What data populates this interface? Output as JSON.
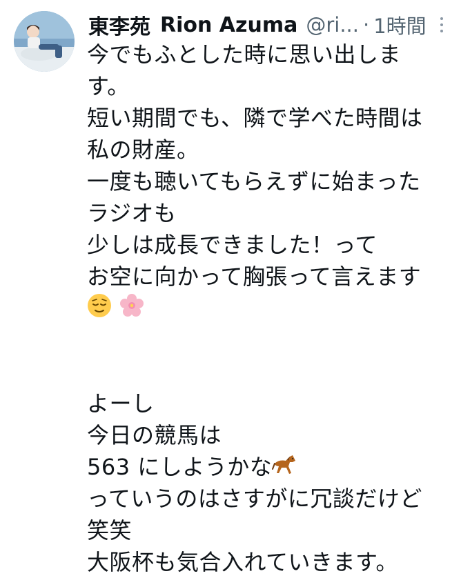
{
  "author": {
    "display_name": "東李苑",
    "latin_name": "Rion Azuma",
    "handle": "@ri...",
    "separator": "·",
    "time": "1時間"
  },
  "tweet": {
    "lines": [
      "今でもふとした時に思い出しま",
      "す。",
      "短い期間でも、隣で学べた時間は",
      "私の財産。",
      "一度も聴いてもらえずに始まった",
      "ラジオも",
      "少しは成長できました！って",
      "お空に向かって胸張って言えます"
    ],
    "emoji_line": [
      "relieved-face-emoji",
      "cherry-blossom-emoji"
    ],
    "lines2": [
      "よーし",
      "今日の競馬は"
    ],
    "horse_line_text": "563 にしようかな",
    "horse_emoji": "horse-emoji",
    "lines3": [
      "っていうのはさすがに冗談だけど",
      "笑笑",
      "大阪杯も気合入れていきます。"
    ]
  },
  "colors": {
    "text": "#0f1419",
    "secondary": "#536471"
  }
}
